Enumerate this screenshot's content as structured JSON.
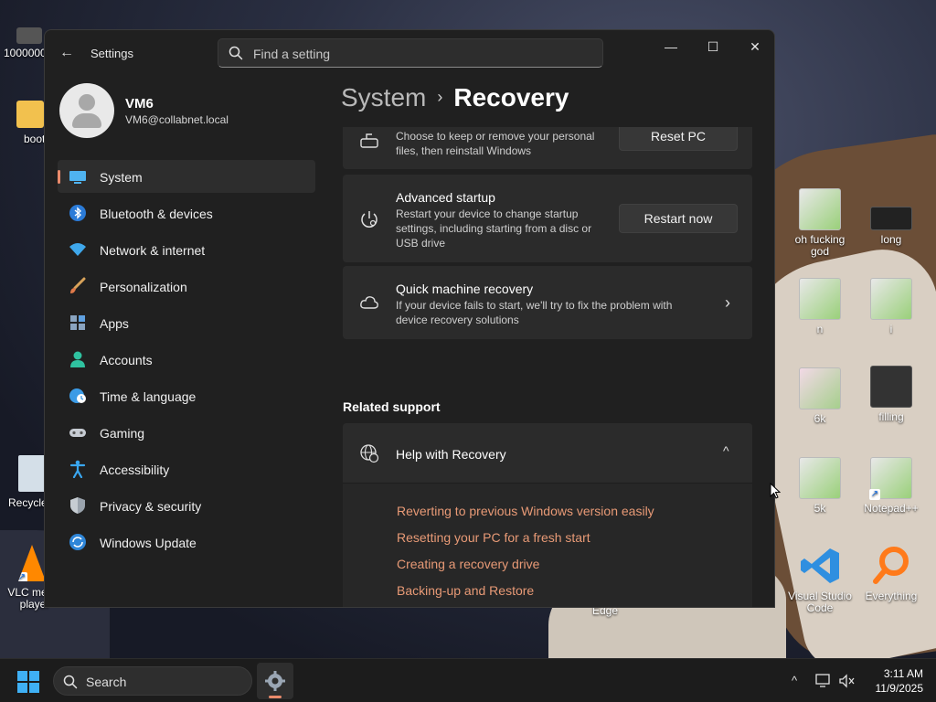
{
  "desktop": {
    "icons": [
      {
        "label": "100000000"
      },
      {
        "label": "boot"
      },
      {
        "label": "Recycle"
      },
      {
        "label": "VLC media player"
      },
      {
        "label": "oh fucking god"
      },
      {
        "label": "long"
      },
      {
        "label": "n"
      },
      {
        "label": "i"
      },
      {
        "label": "6k"
      },
      {
        "label": "filling"
      },
      {
        "label": "5k"
      },
      {
        "label": "Notepad++"
      },
      {
        "label": "Visual Studio Code"
      },
      {
        "label": "Everything"
      },
      {
        "label": "Edge"
      }
    ]
  },
  "window": {
    "title": "Settings",
    "search_placeholder": "Find a setting",
    "controls": {
      "minimize": "—",
      "maximize": "☐",
      "close": "✕"
    },
    "back_glyph": "←"
  },
  "profile": {
    "name": "VM6",
    "email": "VM6@collabnet.local"
  },
  "nav": {
    "items": [
      {
        "label": "System",
        "icon": "display-icon",
        "active": true
      },
      {
        "label": "Bluetooth & devices",
        "icon": "bluetooth-icon"
      },
      {
        "label": "Network & internet",
        "icon": "wifi-icon"
      },
      {
        "label": "Personalization",
        "icon": "paintbrush-icon"
      },
      {
        "label": "Apps",
        "icon": "apps-icon"
      },
      {
        "label": "Accounts",
        "icon": "person-icon"
      },
      {
        "label": "Time & language",
        "icon": "globe-clock-icon"
      },
      {
        "label": "Gaming",
        "icon": "gamepad-icon"
      },
      {
        "label": "Accessibility",
        "icon": "accessibility-icon"
      },
      {
        "label": "Privacy & security",
        "icon": "shield-icon"
      },
      {
        "label": "Windows Update",
        "icon": "update-icon"
      }
    ]
  },
  "breadcrumb": {
    "parent": "System",
    "separator": "›",
    "current": "Recovery"
  },
  "recovery": {
    "reset": {
      "desc": "Choose to keep or remove your personal files, then reinstall Windows",
      "button": "Reset PC"
    },
    "advanced": {
      "title": "Advanced startup",
      "desc": "Restart your device to change startup settings, including starting from a disc or USB drive",
      "button": "Restart now"
    },
    "quick": {
      "title": "Quick machine recovery",
      "desc": "If your device fails to start, we'll try to fix the problem with device recovery solutions",
      "chevron": "›"
    }
  },
  "related_support": {
    "title": "Related support",
    "help_title": "Help with Recovery",
    "chevron": "^",
    "links": [
      "Reverting to previous Windows version easily",
      "Resetting your PC for a fresh start",
      "Creating a recovery drive",
      "Backing-up and Restore"
    ]
  },
  "taskbar": {
    "search_label": "Search",
    "tray_chevron": "^",
    "time": "3:11 AM",
    "date": "11/9/2025"
  },
  "colors": {
    "accent": "#e98a6b",
    "link": "#e89a76",
    "window_bg": "#202020",
    "card_bg": "#2b2b2b"
  }
}
